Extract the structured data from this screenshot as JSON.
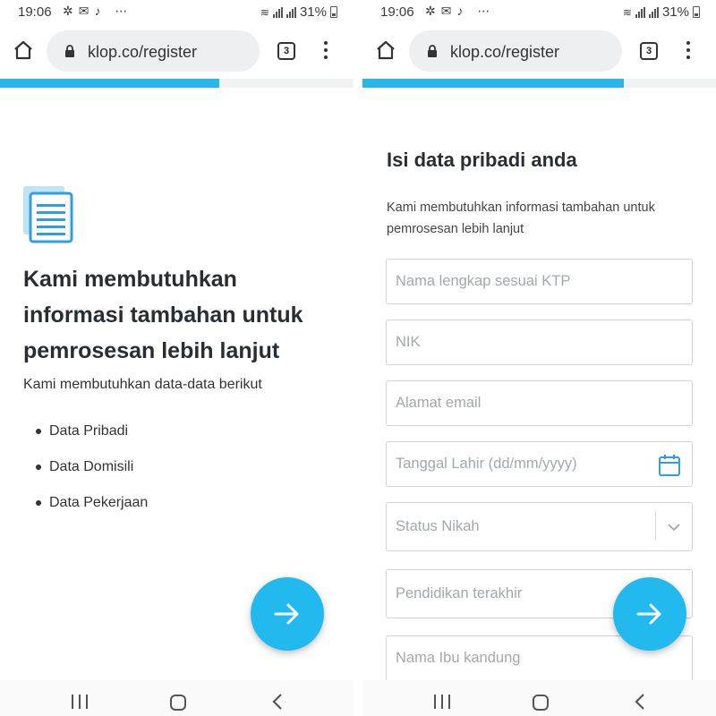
{
  "screens": [
    {
      "status": {
        "time": "19:06",
        "battery": "31%"
      },
      "browser": {
        "url": "klop.co/register",
        "tab_count": "3"
      },
      "progress": 0.62,
      "heading": "Kami membutuhkan informasi tambahan untuk pemrosesan lebih lanjut",
      "subheading": "Kami membutuhkan data-data berikut",
      "bullets": [
        "Data Pribadi",
        "Data Domisili",
        "Data Pekerjaan"
      ]
    },
    {
      "status": {
        "time": "19:06",
        "battery": "31%"
      },
      "browser": {
        "url": "klop.co/register",
        "tab_count": "3"
      },
      "progress": 0.74,
      "title": "Isi data pribadi anda",
      "description": "Kami membutuhkan informasi tambahan untuk pemrosesan lebih lanjut",
      "fields": [
        {
          "placeholder": "Nama lengkap sesuai KTP"
        },
        {
          "placeholder": "NIK"
        },
        {
          "placeholder": "Alamat email"
        },
        {
          "placeholder": "Tanggal Lahir (dd/mm/yyyy)",
          "icon": "calendar-icon"
        },
        {
          "placeholder": "Status Nikah",
          "icon": "chevron-down-icon"
        },
        {
          "placeholder": "Pendidikan terakhir"
        },
        {
          "placeholder": "Nama Ibu kandung"
        }
      ]
    }
  ],
  "colors": {
    "accent": "#22b9ef",
    "progress": "#29b6e8",
    "icon": "#2f9fe0"
  }
}
